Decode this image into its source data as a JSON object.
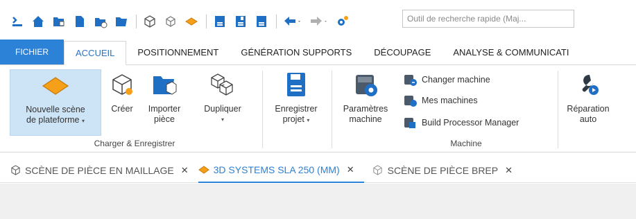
{
  "search": {
    "placeholder": "Outil de recherche rapide (Maj..."
  },
  "tabs": [
    "FICHIER",
    "ACCUEIL",
    "POSITIONNEMENT",
    "GÉNÉRATION SUPPORTS",
    "DÉCOUPAGE",
    "ANALYSE & COMMUNICATI"
  ],
  "ribbon": {
    "nouvelle_1": "Nouvelle scène",
    "nouvelle_2": "de plateforme",
    "creer": "Créer",
    "importer_1": "Importer",
    "importer_2": "pièce",
    "dupliquer": "Dupliquer",
    "group_charger": "Charger & Enregistrer",
    "enregistrer_1": "Enregistrer",
    "enregistrer_2": "projet",
    "parametres_1": "Paramètres",
    "parametres_2": "machine",
    "changer": "Changer machine",
    "mes": "Mes machines",
    "build": "Build Processor Manager",
    "group_machine": "Machine",
    "reparation_1": "Réparation",
    "reparation_2": "auto",
    "caret": "▾"
  },
  "doctabs": [
    {
      "label": "SCÈNE DE PIÈCE EN MAILLAGE",
      "close": "✕"
    },
    {
      "label": "3D SYSTEMS SLA 250 (MM)",
      "close": "✕"
    },
    {
      "label": "SCÈNE DE PIÈCE BREP",
      "close": "✕"
    }
  ],
  "colors": {
    "accent": "#2b82d6",
    "orange": "#f6a01a",
    "selected": "#cde3f6"
  }
}
